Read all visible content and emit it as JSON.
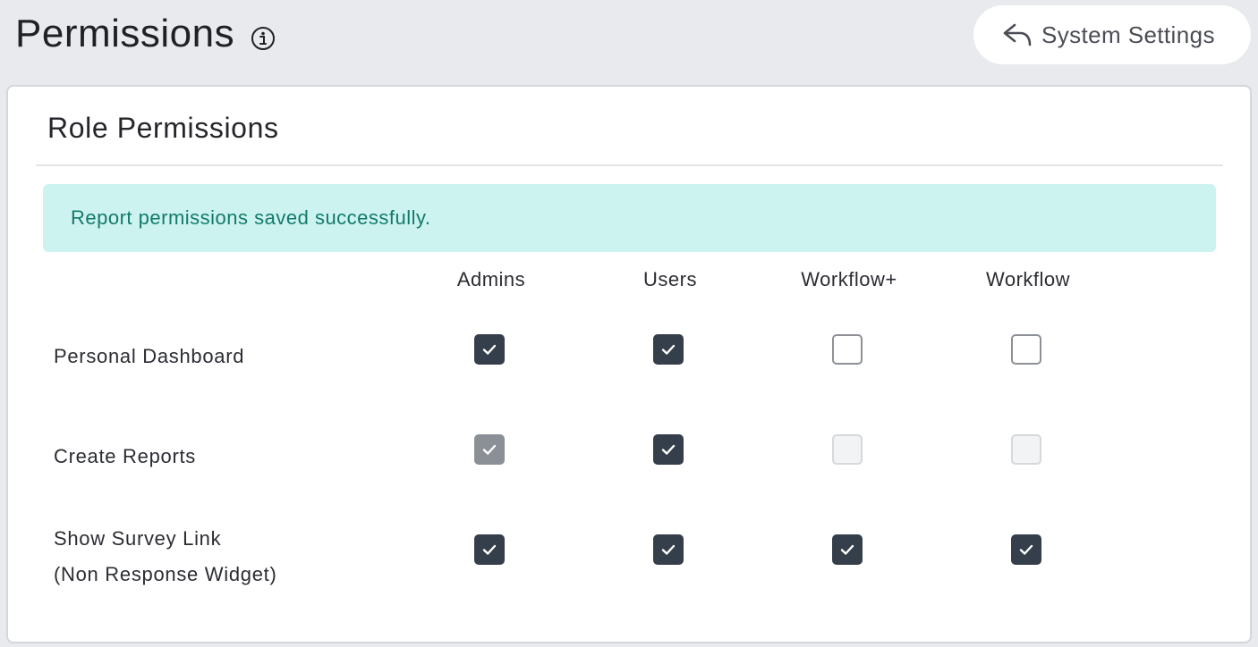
{
  "header": {
    "title": "Permissions",
    "info_icon": "info-circle-icon",
    "settings_button": {
      "label": "System Settings",
      "icon": "reply-arrow-icon"
    }
  },
  "card": {
    "title": "Role Permissions",
    "alert": {
      "message": "Report permissions saved successfully.",
      "type": "success"
    },
    "columns": [
      "Admins",
      "Users",
      "Workflow+",
      "Workflow"
    ],
    "rows": [
      {
        "label": "Personal Dashboard",
        "label_line2": "",
        "cells": [
          "checked",
          "checked",
          "unchecked",
          "unchecked"
        ]
      },
      {
        "label": "Create Reports",
        "label_line2": "",
        "cells": [
          "checked-disabled",
          "checked",
          "unchecked-disabled",
          "unchecked-disabled"
        ]
      },
      {
        "label": "Show Survey Link",
        "label_line2": "(Non Response Widget)",
        "cells": [
          "checked",
          "checked",
          "checked",
          "checked"
        ]
      }
    ]
  },
  "colors": {
    "background": "#e9eaee",
    "checkbox_checked": "#353e4b",
    "alert_bg": "#cdf3f0",
    "alert_text": "#137a6b"
  }
}
